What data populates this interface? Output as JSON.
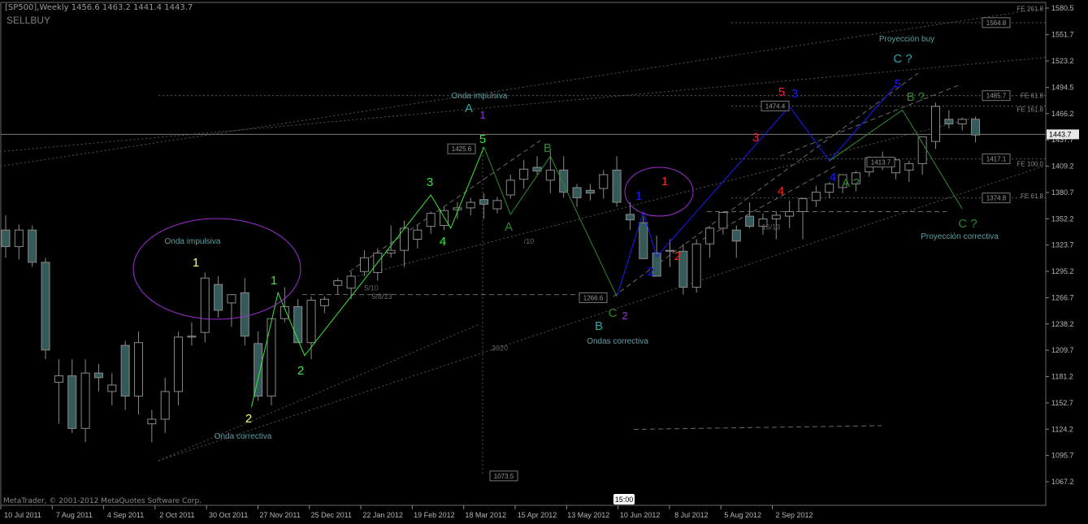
{
  "window": {
    "header": "[SP500],Weekly   1456.6  1463.2  1441.4  1443.7",
    "subtitle": "SELLBUY",
    "copyright": "MetaTrader, © 2001-2012 MetaQuotes Software Corp.",
    "time_marker": "15:00"
  },
  "colors": {
    "background": "#000000",
    "bull_candle": "#000000",
    "bear_candle": "#355a5a",
    "candle_stroke": "#8a8a8a",
    "axis_text": "#b5b5b5",
    "grid": "#5a5a5a",
    "green_wave": "#39e63a",
    "dark_green_wave": "#2e8b2e",
    "blue_wave": "#1a1aff",
    "red_label": "#ff2020",
    "yellow_label": "#ffff66",
    "cyan_label": "#2aa7a7",
    "purple_circle": "#9b30d0",
    "annotation_text": "#5f9ea0"
  },
  "chart_data": {
    "type": "candlestick",
    "ylim": [
      1060,
      1585
    ],
    "y_ticks": [
      "1580.5",
      "1551.7",
      "1523.2",
      "1494.5",
      "1466.2",
      "1437.7",
      "1409.2",
      "1380.7",
      "1352.2",
      "1323.7",
      "1295.2",
      "1266.7",
      "1238.2",
      "1209.7",
      "1181.2",
      "1152.7",
      "1124.2",
      "1095.7",
      "1067.2"
    ],
    "current_price": "1443.7",
    "x_labels": [
      "10 Jul 2011",
      "7 Aug 2011",
      "4 Sep 2011",
      "2 Oct 2011",
      "30 Oct 2011",
      "27 Nov 2011",
      "25 Dec 2011",
      "22 Jan 2012",
      "19 Feb 2012",
      "18 Mar 2012",
      "15 Apr 2012",
      "13 May 2012",
      "10 Jun 2012",
      "8 Jul 2012",
      "5 Aug 2012",
      "2 Sep 2012"
    ],
    "candles": [
      [
        1340,
        1356,
        1310,
        1322
      ],
      [
        1322,
        1346,
        1308,
        1340
      ],
      [
        1340,
        1345,
        1300,
        1305
      ],
      [
        1305,
        1310,
        1200,
        1210
      ],
      [
        1175,
        1200,
        1130,
        1182
      ],
      [
        1182,
        1200,
        1120,
        1125
      ],
      [
        1125,
        1200,
        1110,
        1185
      ],
      [
        1185,
        1195,
        1165,
        1180
      ],
      [
        1165,
        1185,
        1150,
        1172
      ],
      [
        1215,
        1220,
        1145,
        1160
      ],
      [
        1160,
        1230,
        1140,
        1218
      ],
      [
        1130,
        1145,
        1110,
        1135
      ],
      [
        1135,
        1180,
        1120,
        1165
      ],
      [
        1165,
        1230,
        1150,
        1224
      ],
      [
        1224,
        1240,
        1215,
        1225
      ],
      [
        1229,
        1294,
        1218,
        1288
      ],
      [
        1281,
        1290,
        1245,
        1253
      ],
      [
        1261,
        1270,
        1235,
        1270
      ],
      [
        1272,
        1288,
        1215,
        1225
      ],
      [
        1217,
        1230,
        1155,
        1160
      ],
      [
        1160,
        1240,
        1150,
        1244
      ],
      [
        1244,
        1278,
        1240,
        1257
      ],
      [
        1257,
        1265,
        1218,
        1218
      ],
      [
        1218,
        1268,
        1200,
        1264
      ],
      [
        1258,
        1268,
        1250,
        1265
      ],
      [
        1280,
        1288,
        1270,
        1285
      ],
      [
        1277,
        1295,
        1265,
        1290
      ],
      [
        1295,
        1318,
        1290,
        1310
      ],
      [
        1294,
        1320,
        1285,
        1315
      ],
      [
        1315,
        1345,
        1310,
        1318
      ],
      [
        1318,
        1350,
        1300,
        1342
      ],
      [
        1330,
        1345,
        1320,
        1340
      ],
      [
        1344,
        1360,
        1336,
        1358
      ],
      [
        1345,
        1365,
        1340,
        1361
      ],
      [
        1362,
        1370,
        1352,
        1364
      ],
      [
        1364,
        1375,
        1356,
        1370
      ],
      [
        1373,
        1380,
        1352,
        1368
      ],
      [
        1363,
        1376,
        1358,
        1372
      ],
      [
        1378,
        1400,
        1374,
        1394
      ],
      [
        1395,
        1416,
        1385,
        1406
      ],
      [
        1408,
        1420,
        1400,
        1404
      ],
      [
        1394,
        1425,
        1380,
        1405
      ],
      [
        1405,
        1420,
        1375,
        1381
      ],
      [
        1386,
        1390,
        1365,
        1375
      ],
      [
        1383,
        1390,
        1372,
        1380
      ],
      [
        1385,
        1405,
        1374,
        1400
      ],
      [
        1405,
        1420,
        1365,
        1370
      ],
      [
        1357,
        1370,
        1340,
        1351
      ],
      [
        1348,
        1355,
        1310,
        1309
      ],
      [
        1315,
        1334,
        1290,
        1290
      ],
      [
        1317,
        1330,
        1300,
        1318
      ],
      [
        1317,
        1325,
        1270,
        1278
      ],
      [
        1278,
        1330,
        1272,
        1325
      ],
      [
        1325,
        1344,
        1310,
        1342
      ],
      [
        1342,
        1360,
        1335,
        1359
      ],
      [
        1340,
        1345,
        1310,
        1328
      ],
      [
        1355,
        1370,
        1342,
        1344
      ],
      [
        1344,
        1358,
        1335,
        1352
      ],
      [
        1352,
        1360,
        1330,
        1356
      ],
      [
        1355,
        1372,
        1342,
        1360
      ],
      [
        1360,
        1375,
        1330,
        1374
      ],
      [
        1372,
        1388,
        1365,
        1381
      ],
      [
        1381,
        1392,
        1375,
        1390
      ],
      [
        1386,
        1400,
        1380,
        1400
      ],
      [
        1390,
        1404,
        1382,
        1402
      ],
      [
        1403,
        1420,
        1398,
        1418
      ],
      [
        1416,
        1425,
        1405,
        1410
      ],
      [
        1402,
        1418,
        1395,
        1416
      ],
      [
        1405,
        1415,
        1392,
        1412
      ],
      [
        1412,
        1440,
        1400,
        1441
      ],
      [
        1436,
        1478,
        1428,
        1474
      ],
      [
        1460,
        1470,
        1450,
        1455
      ],
      [
        1455,
        1462,
        1448,
        1460
      ],
      [
        1460,
        1463,
        1435,
        1443
      ]
    ],
    "boxed_labels": [
      "1564.8",
      "1485.7",
      "1474.4",
      "1425.6",
      "1417.1",
      "1413.7",
      "1374.8",
      "1266.6",
      "1073.5"
    ],
    "fe_labels": [
      "FE 261.8",
      "FE 61.8",
      "FE 161.8",
      "FE 100.0",
      "FE 61.8"
    ],
    "ratios": [
      "5/10",
      "/10",
      "2020",
      "16/13",
      "5/8/13"
    ],
    "wave_labels": {
      "yellow": [
        "1",
        "2"
      ],
      "green": [
        "1",
        "2",
        "3",
        "4",
        "5"
      ],
      "dark_green": [
        "A",
        "B",
        "C",
        "A ?",
        "B ?",
        "C ?"
      ],
      "cyan": [
        "A",
        "B",
        "C ?"
      ],
      "purple": [
        "1",
        "2"
      ],
      "blue": [
        "1",
        "2",
        "3",
        "4",
        "5"
      ],
      "red": [
        "1",
        "2",
        "3",
        "4",
        "5"
      ]
    },
    "annotations": {
      "onda_impulsiva_left": "Onda impulsiva",
      "onda_impulsiva_top": "Onda impulsiva",
      "onda_correctiva": "Onda correctiva",
      "ondas_correctiva": "Ondas correctiva",
      "proyeccion_buy": "Proyección buy",
      "proyeccion_correctiva": "Proyección correctiva"
    }
  }
}
